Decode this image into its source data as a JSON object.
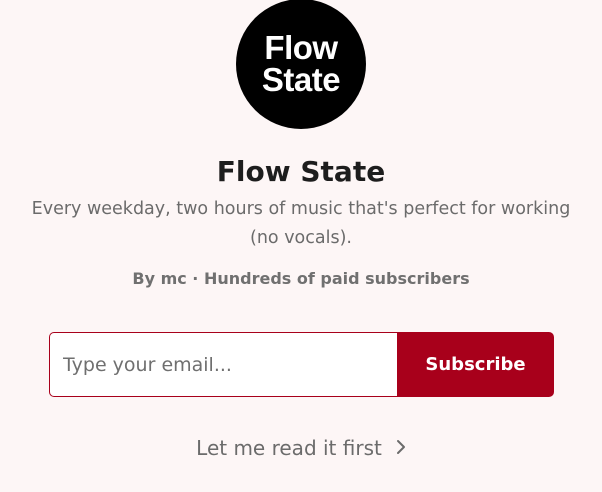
{
  "logo": {
    "line1": "Flow",
    "line2": "State"
  },
  "publication": {
    "title": "Flow State",
    "description": "Every weekday, two hours of music that's perfect for working (no vocals).",
    "byline": "By mc · Hundreds of paid subscribers"
  },
  "subscribe_form": {
    "email_placeholder": "Type your email...",
    "button_label": "Subscribe"
  },
  "read_first": {
    "label": "Let me read it first",
    "icon": "chevron-right-icon"
  },
  "colors": {
    "background": "#fdf6f6",
    "accent": "#a8001b"
  }
}
